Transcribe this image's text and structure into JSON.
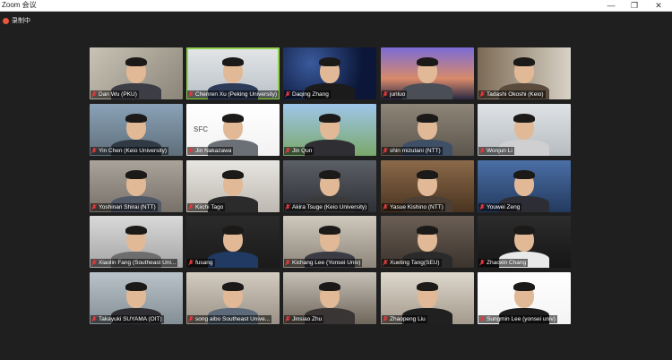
{
  "window": {
    "title": "Zoom 会议",
    "min_icon": "minimize-icon",
    "max_icon": "maximize-icon",
    "close_icon": "close-icon"
  },
  "recording": {
    "label": "录制中"
  },
  "participants": [
    "Dan Wu (PKU)",
    "Chenren Xu (Peking University)",
    "Daqing Zhang",
    "junluo",
    "Tadashi Okoshi (Keio)",
    "Yin Chen (Keio University)",
    "Jin Nakazawa",
    "Jin Qun",
    "shin mizutani (NTT)",
    "Wonjun Li",
    "Yoshinari Shirai (NTT)",
    "Kiichi Tago",
    "Akira Tsuge (Keio University)",
    "Yasue Kishino (NTT)",
    "Youwei Zeng",
    "Xiaolin Fang (Southeast Uni...",
    "fusang",
    "Kichang Lee (Yonsei Univ)",
    "Xueting Tang(SEU)",
    "Zhaoxin Chang",
    "Takayuki SUYAMA (OIT)",
    "song aibo Southeast Unive...",
    "Jinsiao Zhu",
    "Zhaopeng Liu",
    "Sungmin Lee (yonsei univ)"
  ],
  "colors": {
    "active_speaker": "#8fd14f",
    "muted_mic": "#e23a3a",
    "recording": "#e8593c"
  },
  "icons": {
    "mic": "mic-muted-icon",
    "rec": "record-dot-icon"
  },
  "sfc_logo": "SFC"
}
